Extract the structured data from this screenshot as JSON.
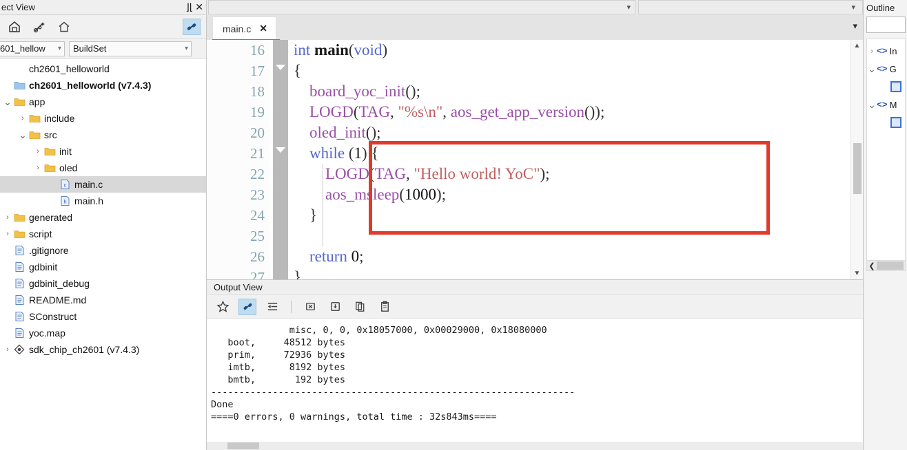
{
  "project_view": {
    "title": "ect View",
    "dock_icon": "dock-icon",
    "close_icon": "close-icon",
    "toolbar": [
      {
        "name": "build-icon",
        "label": "Build"
      },
      {
        "name": "magic-wand-icon",
        "label": "Configure"
      },
      {
        "name": "home-icon",
        "label": "Home"
      }
    ],
    "link_button": {
      "name": "link-icon",
      "label": "Link with Editor",
      "active": true
    },
    "project_combo": {
      "value": "601_hellow",
      "placeholder": "Project"
    },
    "buildset_combo": {
      "value": "BuildSet",
      "placeholder": "BuildSet"
    },
    "tree": [
      {
        "indent": 0,
        "twisty": "",
        "icon": "none",
        "label": "ch2601_helloworld",
        "bold": false,
        "selected": false
      },
      {
        "indent": 0,
        "twisty": "",
        "icon": "folder-blue",
        "label": "ch2601_helloworld (v7.4.3)",
        "bold": true,
        "selected": false
      },
      {
        "indent": 0,
        "twisty": "v",
        "icon": "folder",
        "label": "app",
        "bold": false,
        "selected": false
      },
      {
        "indent": 1,
        "twisty": ">",
        "icon": "folder",
        "label": "include",
        "bold": false,
        "selected": false
      },
      {
        "indent": 1,
        "twisty": "v",
        "icon": "folder",
        "label": "src",
        "bold": false,
        "selected": false
      },
      {
        "indent": 2,
        "twisty": ">",
        "icon": "folder",
        "label": "init",
        "bold": false,
        "selected": false
      },
      {
        "indent": 2,
        "twisty": ">",
        "icon": "folder",
        "label": "oled",
        "bold": false,
        "selected": false
      },
      {
        "indent": 3,
        "twisty": "",
        "icon": "file-c",
        "label": "main.c",
        "bold": false,
        "selected": true
      },
      {
        "indent": 3,
        "twisty": "",
        "icon": "file-h",
        "label": "main.h",
        "bold": false,
        "selected": false
      },
      {
        "indent": 0,
        "twisty": ">",
        "icon": "folder",
        "label": "generated",
        "bold": false,
        "selected": false
      },
      {
        "indent": 0,
        "twisty": ">",
        "icon": "folder",
        "label": "script",
        "bold": false,
        "selected": false
      },
      {
        "indent": 0,
        "twisty": "",
        "icon": "file",
        "label": ".gitignore",
        "bold": false,
        "selected": false
      },
      {
        "indent": 0,
        "twisty": "",
        "icon": "file",
        "label": "gdbinit",
        "bold": false,
        "selected": false
      },
      {
        "indent": 0,
        "twisty": "",
        "icon": "file",
        "label": "gdbinit_debug",
        "bold": false,
        "selected": false
      },
      {
        "indent": 0,
        "twisty": "",
        "icon": "file",
        "label": "README.md",
        "bold": false,
        "selected": false
      },
      {
        "indent": 0,
        "twisty": "",
        "icon": "file",
        "label": "SConstruct",
        "bold": false,
        "selected": false
      },
      {
        "indent": 0,
        "twisty": "",
        "icon": "file",
        "label": "yoc.map",
        "bold": false,
        "selected": false
      },
      {
        "indent": 0,
        "twisty": ">",
        "icon": "chip",
        "label": "sdk_chip_ch2601 (v7.4.3)",
        "bold": false,
        "selected": false
      }
    ]
  },
  "editor": {
    "tab": {
      "label": "main.c",
      "close_icon": "close-icon"
    },
    "tab_overflow_icon": "chevron-down-icon",
    "top_combo_left_icon": "chevron-down-icon",
    "top_combo_right_icon": "chevron-down-icon",
    "line_numbers": [
      "16",
      "17",
      "18",
      "19",
      "20",
      "21",
      "22",
      "23",
      "24",
      "25",
      "26",
      "27"
    ],
    "code_lines": [
      {
        "n": "16",
        "tokens": [
          {
            "t": "int ",
            "c": "kw"
          },
          {
            "t": "main",
            "c": "type"
          },
          {
            "t": "(",
            "c": "pl"
          },
          {
            "t": "void",
            "c": "kw"
          },
          {
            "t": ")",
            "c": "pl"
          }
        ]
      },
      {
        "n": "17",
        "tokens": [
          {
            "t": "{",
            "c": "pl"
          }
        ]
      },
      {
        "n": "18",
        "tokens": [
          {
            "t": "    ",
            "c": "pl"
          },
          {
            "t": "board_yoc_init",
            "c": "fn"
          },
          {
            "t": "();",
            "c": "pl"
          }
        ]
      },
      {
        "n": "19",
        "tokens": [
          {
            "t": "    ",
            "c": "pl"
          },
          {
            "t": "LOGD",
            "c": "fn"
          },
          {
            "t": "(",
            "c": "pl"
          },
          {
            "t": "TAG",
            "c": "fn"
          },
          {
            "t": ", ",
            "c": "pl"
          },
          {
            "t": "\"%s\\n\"",
            "c": "str"
          },
          {
            "t": ", ",
            "c": "pl"
          },
          {
            "t": "aos_get_app_version",
            "c": "fn"
          },
          {
            "t": "());",
            "c": "pl"
          }
        ]
      },
      {
        "n": "20",
        "tokens": [
          {
            "t": "    ",
            "c": "pl"
          },
          {
            "t": "oled_init",
            "c": "fn"
          },
          {
            "t": "();",
            "c": "pl"
          }
        ]
      },
      {
        "n": "21",
        "tokens": [
          {
            "t": "    ",
            "c": "pl"
          },
          {
            "t": "while",
            "c": "kw"
          },
          {
            "t": " (",
            "c": "pl"
          },
          {
            "t": "1",
            "c": "num"
          },
          {
            "t": ") {",
            "c": "pl"
          }
        ]
      },
      {
        "n": "22",
        "tokens": [
          {
            "t": "        ",
            "c": "pl"
          },
          {
            "t": "LOGD",
            "c": "fn"
          },
          {
            "t": "(",
            "c": "pl"
          },
          {
            "t": "TAG",
            "c": "fn"
          },
          {
            "t": ", ",
            "c": "pl"
          },
          {
            "t": "\"Hello world! YoC\"",
            "c": "str"
          },
          {
            "t": ");",
            "c": "pl"
          }
        ]
      },
      {
        "n": "23",
        "tokens": [
          {
            "t": "        ",
            "c": "pl"
          },
          {
            "t": "aos_msleep",
            "c": "fn"
          },
          {
            "t": "(",
            "c": "pl"
          },
          {
            "t": "1000",
            "c": "num"
          },
          {
            "t": ");",
            "c": "pl"
          }
        ]
      },
      {
        "n": "24",
        "tokens": [
          {
            "t": "    }",
            "c": "pl"
          }
        ]
      },
      {
        "n": "25",
        "tokens": [
          {
            "t": "",
            "c": "pl"
          }
        ]
      },
      {
        "n": "26",
        "tokens": [
          {
            "t": "    ",
            "c": "pl"
          },
          {
            "t": "return",
            "c": "kw"
          },
          {
            "t": " ",
            "c": "pl"
          },
          {
            "t": "0",
            "c": "num"
          },
          {
            "t": ";",
            "c": "pl"
          }
        ]
      },
      {
        "n": "27",
        "tokens": [
          {
            "t": "}",
            "c": "pl"
          }
        ]
      }
    ],
    "annotation": {
      "type": "red-rectangle",
      "color": "#e03a28"
    },
    "colors": {
      "keyword": "#5566cc",
      "function": "#9a4fa8",
      "string": "#c35f5f",
      "number": "#111111",
      "line_number": "#83a6ad",
      "tab_active_underline": "#2196d9"
    },
    "scrollbar": {
      "up_icon": "chevron-up-icon",
      "down_icon": "chevron-down-icon"
    }
  },
  "output_view": {
    "title": "Output View",
    "toolbar": [
      {
        "name": "favorite-star-icon",
        "label": "Favorite",
        "active": false
      },
      {
        "name": "link-icon",
        "label": "Link",
        "active": true
      },
      {
        "name": "wrap-lines-icon",
        "label": "Wrap Lines",
        "active": false
      },
      {
        "name": "clear-icon",
        "label": "Clear",
        "active": false
      },
      {
        "name": "save-icon",
        "label": "Save",
        "active": false
      },
      {
        "name": "copy-icon",
        "label": "Copy",
        "active": false
      },
      {
        "name": "paste-icon",
        "label": "Paste",
        "active": false
      }
    ],
    "log": [
      "              misc, 0, 0, 0x18057000, 0x00029000, 0x18080000",
      "   boot,     48512 bytes",
      "   prim,     72936 bytes",
      "   imtb,      8192 bytes",
      "   bmtb,       192 bytes",
      "-----------------------------------------------------------------",
      "Done",
      "====0 errors, 0 warnings, total time : 32s843ms===="
    ]
  },
  "outline": {
    "title": "Outline",
    "search_placeholder": "",
    "search_value": "",
    "items": [
      {
        "twisty": ">",
        "icon": "code-brackets-icon",
        "label": "In",
        "child": false
      },
      {
        "twisty": "v",
        "icon": "code-brackets-icon",
        "label": "G",
        "child": false
      },
      {
        "twisty": "",
        "icon": "member-chip-icon",
        "label": "",
        "child": true
      },
      {
        "twisty": "v",
        "icon": "code-brackets-icon",
        "label": "M",
        "child": false
      },
      {
        "twisty": "",
        "icon": "member-chip-icon",
        "label": "",
        "child": true
      }
    ],
    "hscroll_left_icon": "chevron-left-icon"
  }
}
